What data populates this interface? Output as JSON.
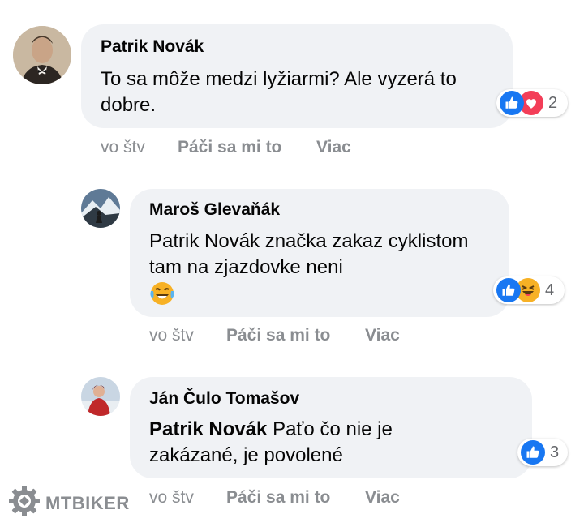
{
  "comments": [
    {
      "author": "Patrik Novák",
      "text": "To sa môže medzi lyžiarmi? Ale vyzerá to dobre.",
      "reactions": [
        "like-icon",
        "love-icon"
      ],
      "reaction_count": "2",
      "time": "vo štv",
      "like_label": "Páči sa mi to",
      "more_label": "Viac"
    },
    {
      "author": "Maroš Glevaňák",
      "text": "Patrik Novák značka zakaz cyklistom tam na zjazdovke neni",
      "reactions": [
        "like-icon",
        "haha-icon"
      ],
      "reaction_count": "4",
      "time": "vo štv",
      "like_label": "Páči sa mi to",
      "more_label": "Viac"
    },
    {
      "author": "Ján Čulo Tomašov",
      "mention": "Patrik Novák",
      "text": "Paťo čo nie je zakázané, je povolené",
      "reactions": [
        "like-icon"
      ],
      "reaction_count": "3",
      "time": "vo štv",
      "like_label": "Páči sa mi to",
      "more_label": "Viac"
    }
  ],
  "watermark": "MTBIKER",
  "colors": {
    "bubble": "#f0f2f5",
    "like_blue": "#1877f2",
    "love_red": "#f33e58",
    "haha_yellow": "#f7b125",
    "meta_gray": "#8a8d91"
  }
}
